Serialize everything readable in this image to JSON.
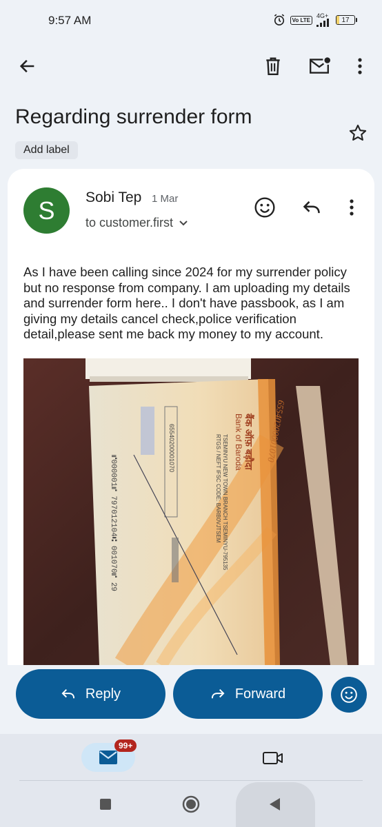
{
  "status_bar": {
    "time": "9:57 AM",
    "network": "4G+",
    "volte": "Vo LTE",
    "battery": "17",
    "battery_level": 0.17
  },
  "toolbar": {
    "back_icon": "arrow-left-icon",
    "delete_icon": "trash-icon",
    "mark_unread_icon": "mail-unread-icon",
    "more_icon": "more-vert-icon"
  },
  "email": {
    "subject": "Regarding surrender form",
    "label_button": "Add label",
    "star_icon": "star-outline-icon",
    "sender": {
      "initial": "S",
      "name": "Sobi Tep",
      "date": "1 Mar",
      "avatar_color": "#2e7d32"
    },
    "recipient": "to customer.first",
    "body": "As I have been calling since 2024 for my surrender policy but no response from company. I am uploading my details and surrender form here.. I don't have passbook, as I am giving my details cancel check,police verification detail,please sent me back my money to my account.",
    "attachment": {
      "description_icon": "cheque-photo",
      "account_no": "65540200001070",
      "bank_name": "Bank of Baroda",
      "bank_name_local": "बैंक ऑफ़ बड़ौदा",
      "branch": "TSEMINYU NEW TOWN BRANCH TSEMINYU-795135",
      "ifsc": "RTGS / NEFT IFSC CODE: BARB0VJTSEM",
      "cheque_no": "⑈000001⑈ 797012104⑆ 001070⑈ 29",
      "handwritten": "65540200001070"
    }
  },
  "actions": {
    "reply": "Reply",
    "forward": "Forward",
    "reply_icon": "reply-icon",
    "forward_icon": "forward-icon",
    "emoji_icon": "emoji-icon",
    "accent": "#0b5c96"
  },
  "bottom_nav": {
    "mail_badge": "99+",
    "mail_icon": "mail-icon",
    "meet_icon": "video-icon"
  },
  "system_nav": {
    "recents_icon": "square-icon",
    "home_icon": "circle-icon",
    "back_icon": "triangle-back-icon"
  }
}
